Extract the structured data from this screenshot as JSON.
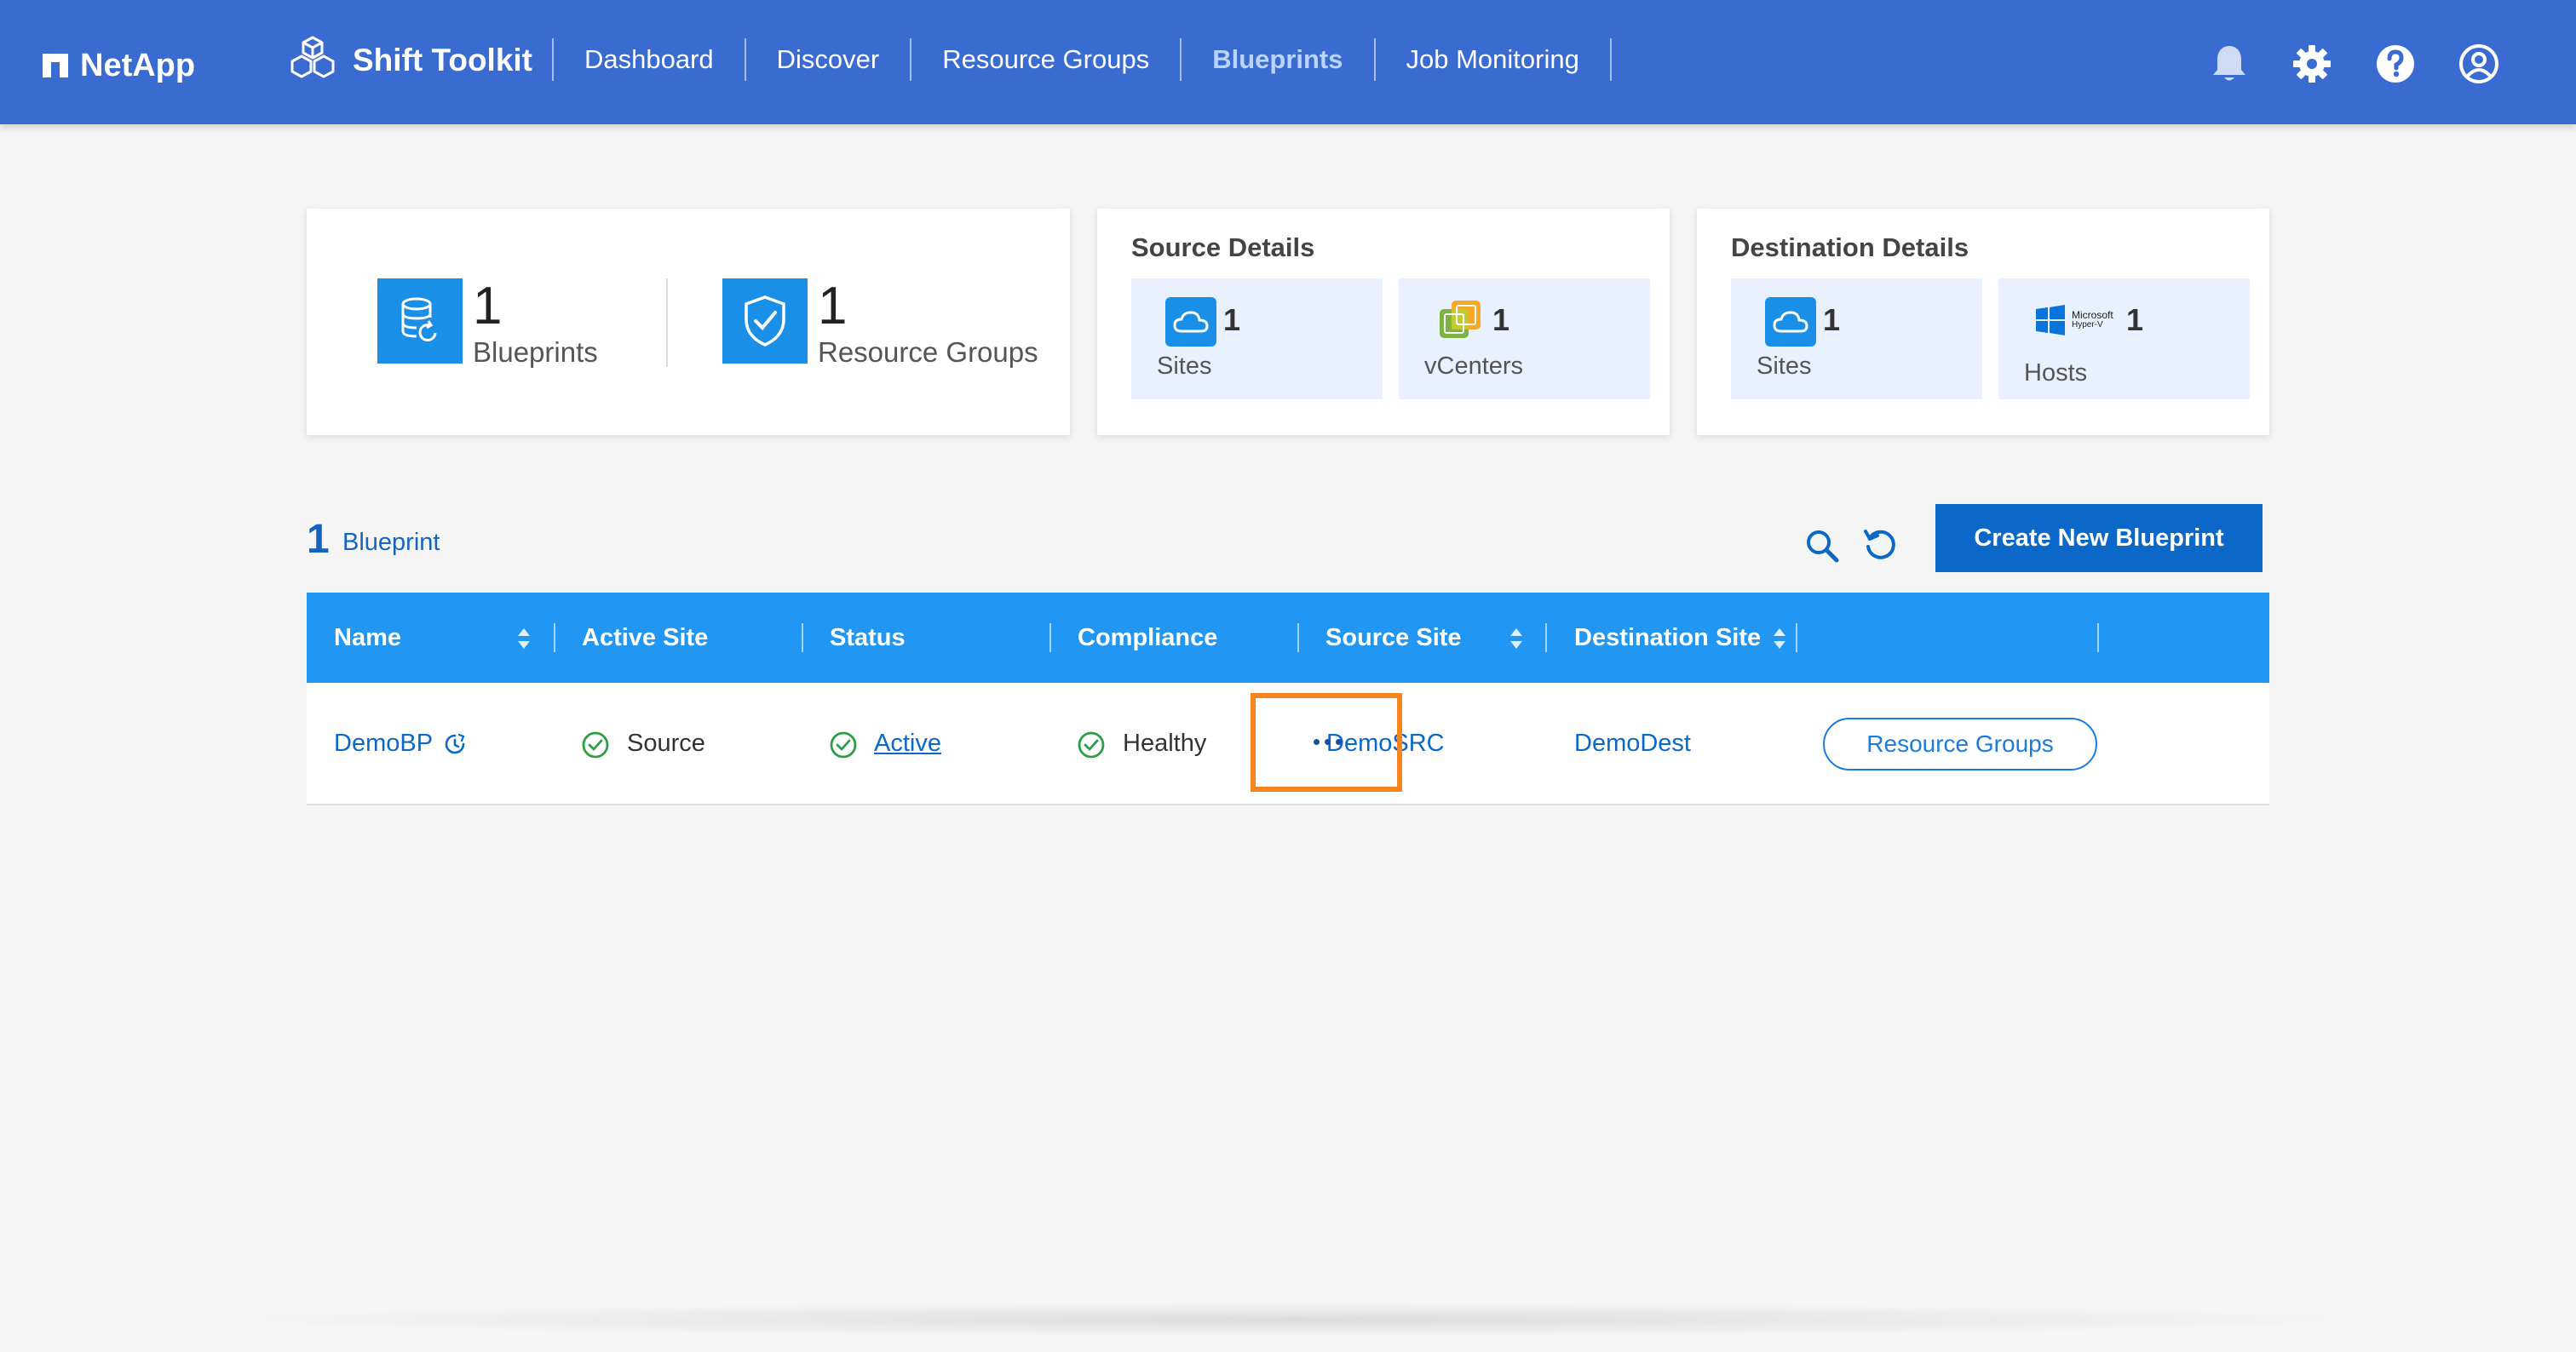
{
  "header": {
    "brand": "NetApp",
    "app_title": "Shift Toolkit",
    "nav": [
      "Dashboard",
      "Discover",
      "Resource Groups",
      "Blueprints",
      "Job Monitoring"
    ],
    "active_nav": "Blueprints",
    "icons": [
      "bell-icon",
      "gear-icon",
      "help-icon",
      "user-icon"
    ]
  },
  "summary": {
    "blueprints": {
      "count": "1",
      "label": "Blueprints",
      "icon": "database-refresh-icon"
    },
    "resource_groups": {
      "count": "1",
      "label": "Resource Groups",
      "icon": "shield-check-icon"
    }
  },
  "source_details": {
    "title": "Source Details",
    "sites": {
      "count": "1",
      "label": "Sites",
      "icon": "cloud-icon"
    },
    "vcenters": {
      "count": "1",
      "label": "vCenters",
      "icon": "vmware-icon"
    }
  },
  "destination_details": {
    "title": "Destination Details",
    "sites": {
      "count": "1",
      "label": "Sites",
      "icon": "cloud-icon"
    },
    "hosts": {
      "count": "1",
      "label": "Hosts",
      "icon": "hyperv-icon",
      "logo_text": "Microsoft Hyper-V"
    }
  },
  "list": {
    "count": "1",
    "label": "Blueprint",
    "create_button": "Create New Blueprint"
  },
  "table": {
    "columns": [
      "Name",
      "Active Site",
      "Status",
      "Compliance",
      "Source Site",
      "Destination Site"
    ],
    "rows": [
      {
        "name": "DemoBP",
        "active_site": "Source",
        "status": "Active",
        "compliance": "Healthy",
        "source_site": "DemoSRC",
        "destination_site": "DemoDest",
        "action_button": "Resource Groups",
        "more": "..."
      }
    ]
  },
  "colors": {
    "header_bg": "#3a6bd1",
    "table_header_bg": "#2196f3",
    "primary": "#0b68c8",
    "success": "#2e9e44",
    "highlight": "#f7851e"
  }
}
